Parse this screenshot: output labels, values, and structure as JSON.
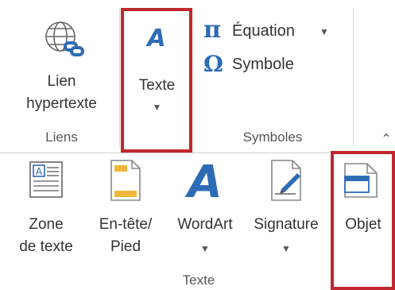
{
  "ribbon_top": {
    "links_group": {
      "hyperlink_line1": "Lien",
      "hyperlink_line2": "hypertexte",
      "group_label": "Liens"
    },
    "text_button": {
      "label": "Texte"
    },
    "symbols_group": {
      "equation_label": "Équation",
      "symbol_label": "Symbole",
      "group_label": "Symboles"
    }
  },
  "ribbon_text_group": {
    "items": [
      {
        "line1": "Zone",
        "line2": "de texte"
      },
      {
        "line1": "En-tête/",
        "line2": "Pied"
      },
      {
        "line1": "WordArt"
      },
      {
        "line1": "Signature"
      },
      {
        "line1": "Objet"
      }
    ],
    "group_label": "Texte"
  },
  "icons": {
    "hyperlink": "globe-link-icon",
    "text": "text-a-icon",
    "equation": "pi-icon",
    "symbol": "omega-icon",
    "textbox": "textbox-icon",
    "header_footer": "header-footer-icon",
    "wordart": "wordart-icon",
    "signature": "signature-line-icon",
    "object": "object-icon"
  },
  "colors": {
    "highlight": "#c0282e",
    "accent": "#2e6bb5",
    "header_yellow": "#f0b73a"
  }
}
